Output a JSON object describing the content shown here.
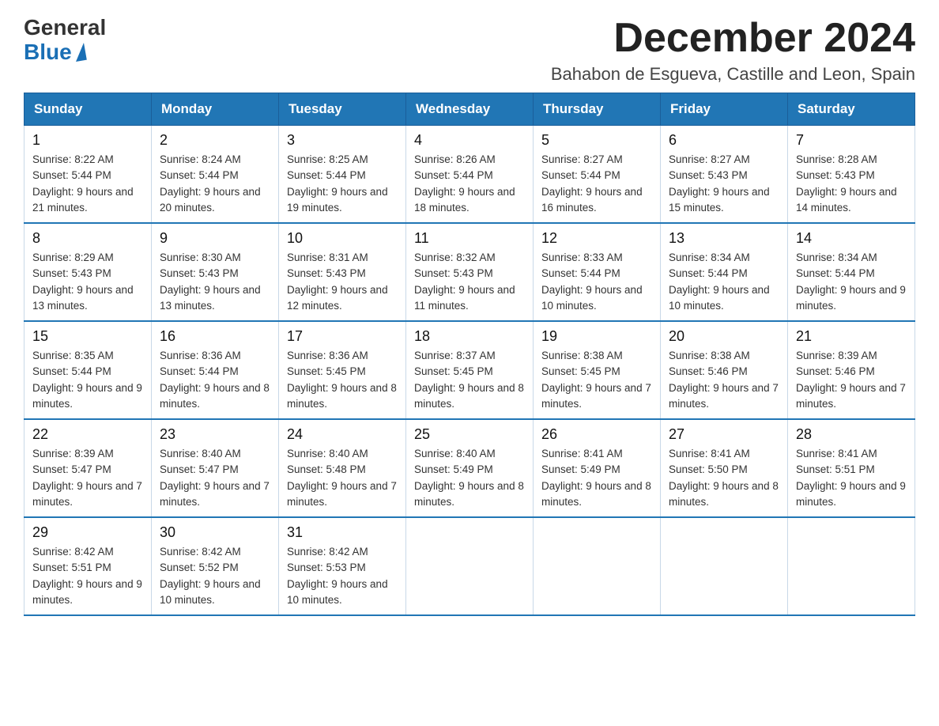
{
  "logo": {
    "general": "General",
    "blue": "Blue"
  },
  "title": "December 2024",
  "location": "Bahabon de Esgueva, Castille and Leon, Spain",
  "headers": [
    "Sunday",
    "Monday",
    "Tuesday",
    "Wednesday",
    "Thursday",
    "Friday",
    "Saturday"
  ],
  "weeks": [
    [
      {
        "day": "1",
        "sunrise": "8:22 AM",
        "sunset": "5:44 PM",
        "daylight": "9 hours and 21 minutes."
      },
      {
        "day": "2",
        "sunrise": "8:24 AM",
        "sunset": "5:44 PM",
        "daylight": "9 hours and 20 minutes."
      },
      {
        "day": "3",
        "sunrise": "8:25 AM",
        "sunset": "5:44 PM",
        "daylight": "9 hours and 19 minutes."
      },
      {
        "day": "4",
        "sunrise": "8:26 AM",
        "sunset": "5:44 PM",
        "daylight": "9 hours and 18 minutes."
      },
      {
        "day": "5",
        "sunrise": "8:27 AM",
        "sunset": "5:44 PM",
        "daylight": "9 hours and 16 minutes."
      },
      {
        "day": "6",
        "sunrise": "8:27 AM",
        "sunset": "5:43 PM",
        "daylight": "9 hours and 15 minutes."
      },
      {
        "day": "7",
        "sunrise": "8:28 AM",
        "sunset": "5:43 PM",
        "daylight": "9 hours and 14 minutes."
      }
    ],
    [
      {
        "day": "8",
        "sunrise": "8:29 AM",
        "sunset": "5:43 PM",
        "daylight": "9 hours and 13 minutes."
      },
      {
        "day": "9",
        "sunrise": "8:30 AM",
        "sunset": "5:43 PM",
        "daylight": "9 hours and 13 minutes."
      },
      {
        "day": "10",
        "sunrise": "8:31 AM",
        "sunset": "5:43 PM",
        "daylight": "9 hours and 12 minutes."
      },
      {
        "day": "11",
        "sunrise": "8:32 AM",
        "sunset": "5:43 PM",
        "daylight": "9 hours and 11 minutes."
      },
      {
        "day": "12",
        "sunrise": "8:33 AM",
        "sunset": "5:44 PM",
        "daylight": "9 hours and 10 minutes."
      },
      {
        "day": "13",
        "sunrise": "8:34 AM",
        "sunset": "5:44 PM",
        "daylight": "9 hours and 10 minutes."
      },
      {
        "day": "14",
        "sunrise": "8:34 AM",
        "sunset": "5:44 PM",
        "daylight": "9 hours and 9 minutes."
      }
    ],
    [
      {
        "day": "15",
        "sunrise": "8:35 AM",
        "sunset": "5:44 PM",
        "daylight": "9 hours and 9 minutes."
      },
      {
        "day": "16",
        "sunrise": "8:36 AM",
        "sunset": "5:44 PM",
        "daylight": "9 hours and 8 minutes."
      },
      {
        "day": "17",
        "sunrise": "8:36 AM",
        "sunset": "5:45 PM",
        "daylight": "9 hours and 8 minutes."
      },
      {
        "day": "18",
        "sunrise": "8:37 AM",
        "sunset": "5:45 PM",
        "daylight": "9 hours and 8 minutes."
      },
      {
        "day": "19",
        "sunrise": "8:38 AM",
        "sunset": "5:45 PM",
        "daylight": "9 hours and 7 minutes."
      },
      {
        "day": "20",
        "sunrise": "8:38 AM",
        "sunset": "5:46 PM",
        "daylight": "9 hours and 7 minutes."
      },
      {
        "day": "21",
        "sunrise": "8:39 AM",
        "sunset": "5:46 PM",
        "daylight": "9 hours and 7 minutes."
      }
    ],
    [
      {
        "day": "22",
        "sunrise": "8:39 AM",
        "sunset": "5:47 PM",
        "daylight": "9 hours and 7 minutes."
      },
      {
        "day": "23",
        "sunrise": "8:40 AM",
        "sunset": "5:47 PM",
        "daylight": "9 hours and 7 minutes."
      },
      {
        "day": "24",
        "sunrise": "8:40 AM",
        "sunset": "5:48 PM",
        "daylight": "9 hours and 7 minutes."
      },
      {
        "day": "25",
        "sunrise": "8:40 AM",
        "sunset": "5:49 PM",
        "daylight": "9 hours and 8 minutes."
      },
      {
        "day": "26",
        "sunrise": "8:41 AM",
        "sunset": "5:49 PM",
        "daylight": "9 hours and 8 minutes."
      },
      {
        "day": "27",
        "sunrise": "8:41 AM",
        "sunset": "5:50 PM",
        "daylight": "9 hours and 8 minutes."
      },
      {
        "day": "28",
        "sunrise": "8:41 AM",
        "sunset": "5:51 PM",
        "daylight": "9 hours and 9 minutes."
      }
    ],
    [
      {
        "day": "29",
        "sunrise": "8:42 AM",
        "sunset": "5:51 PM",
        "daylight": "9 hours and 9 minutes."
      },
      {
        "day": "30",
        "sunrise": "8:42 AM",
        "sunset": "5:52 PM",
        "daylight": "9 hours and 10 minutes."
      },
      {
        "day": "31",
        "sunrise": "8:42 AM",
        "sunset": "5:53 PM",
        "daylight": "9 hours and 10 minutes."
      },
      null,
      null,
      null,
      null
    ]
  ]
}
